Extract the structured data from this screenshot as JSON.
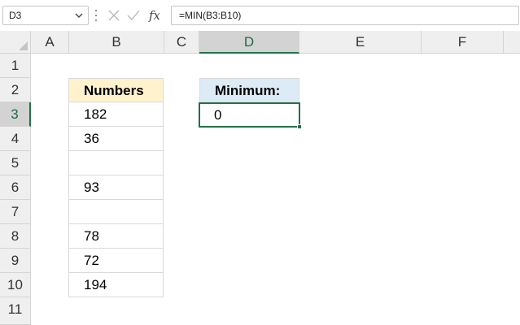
{
  "formula_bar": {
    "name_box": "D3",
    "cancel_icon": "close-icon",
    "enter_icon": "check-icon",
    "function_label": "fx",
    "formula": "=MIN(B3:B10)"
  },
  "columns": [
    "A",
    "B",
    "C",
    "D",
    "E",
    "F"
  ],
  "rows": [
    "1",
    "2",
    "3",
    "4",
    "5",
    "6",
    "7",
    "8",
    "9",
    "10",
    "11"
  ],
  "selected_cell": "D3",
  "cells": {
    "b_header": "Numbers",
    "b_values": [
      "182",
      "36",
      "",
      "93",
      "",
      "78",
      "72",
      "194"
    ],
    "d_header": "Minimum:",
    "d_value": "0"
  },
  "colors": {
    "accent": "#217346",
    "numbers_header_fill": "#FFF2CC",
    "minimum_header_fill": "#DDEBF7"
  }
}
